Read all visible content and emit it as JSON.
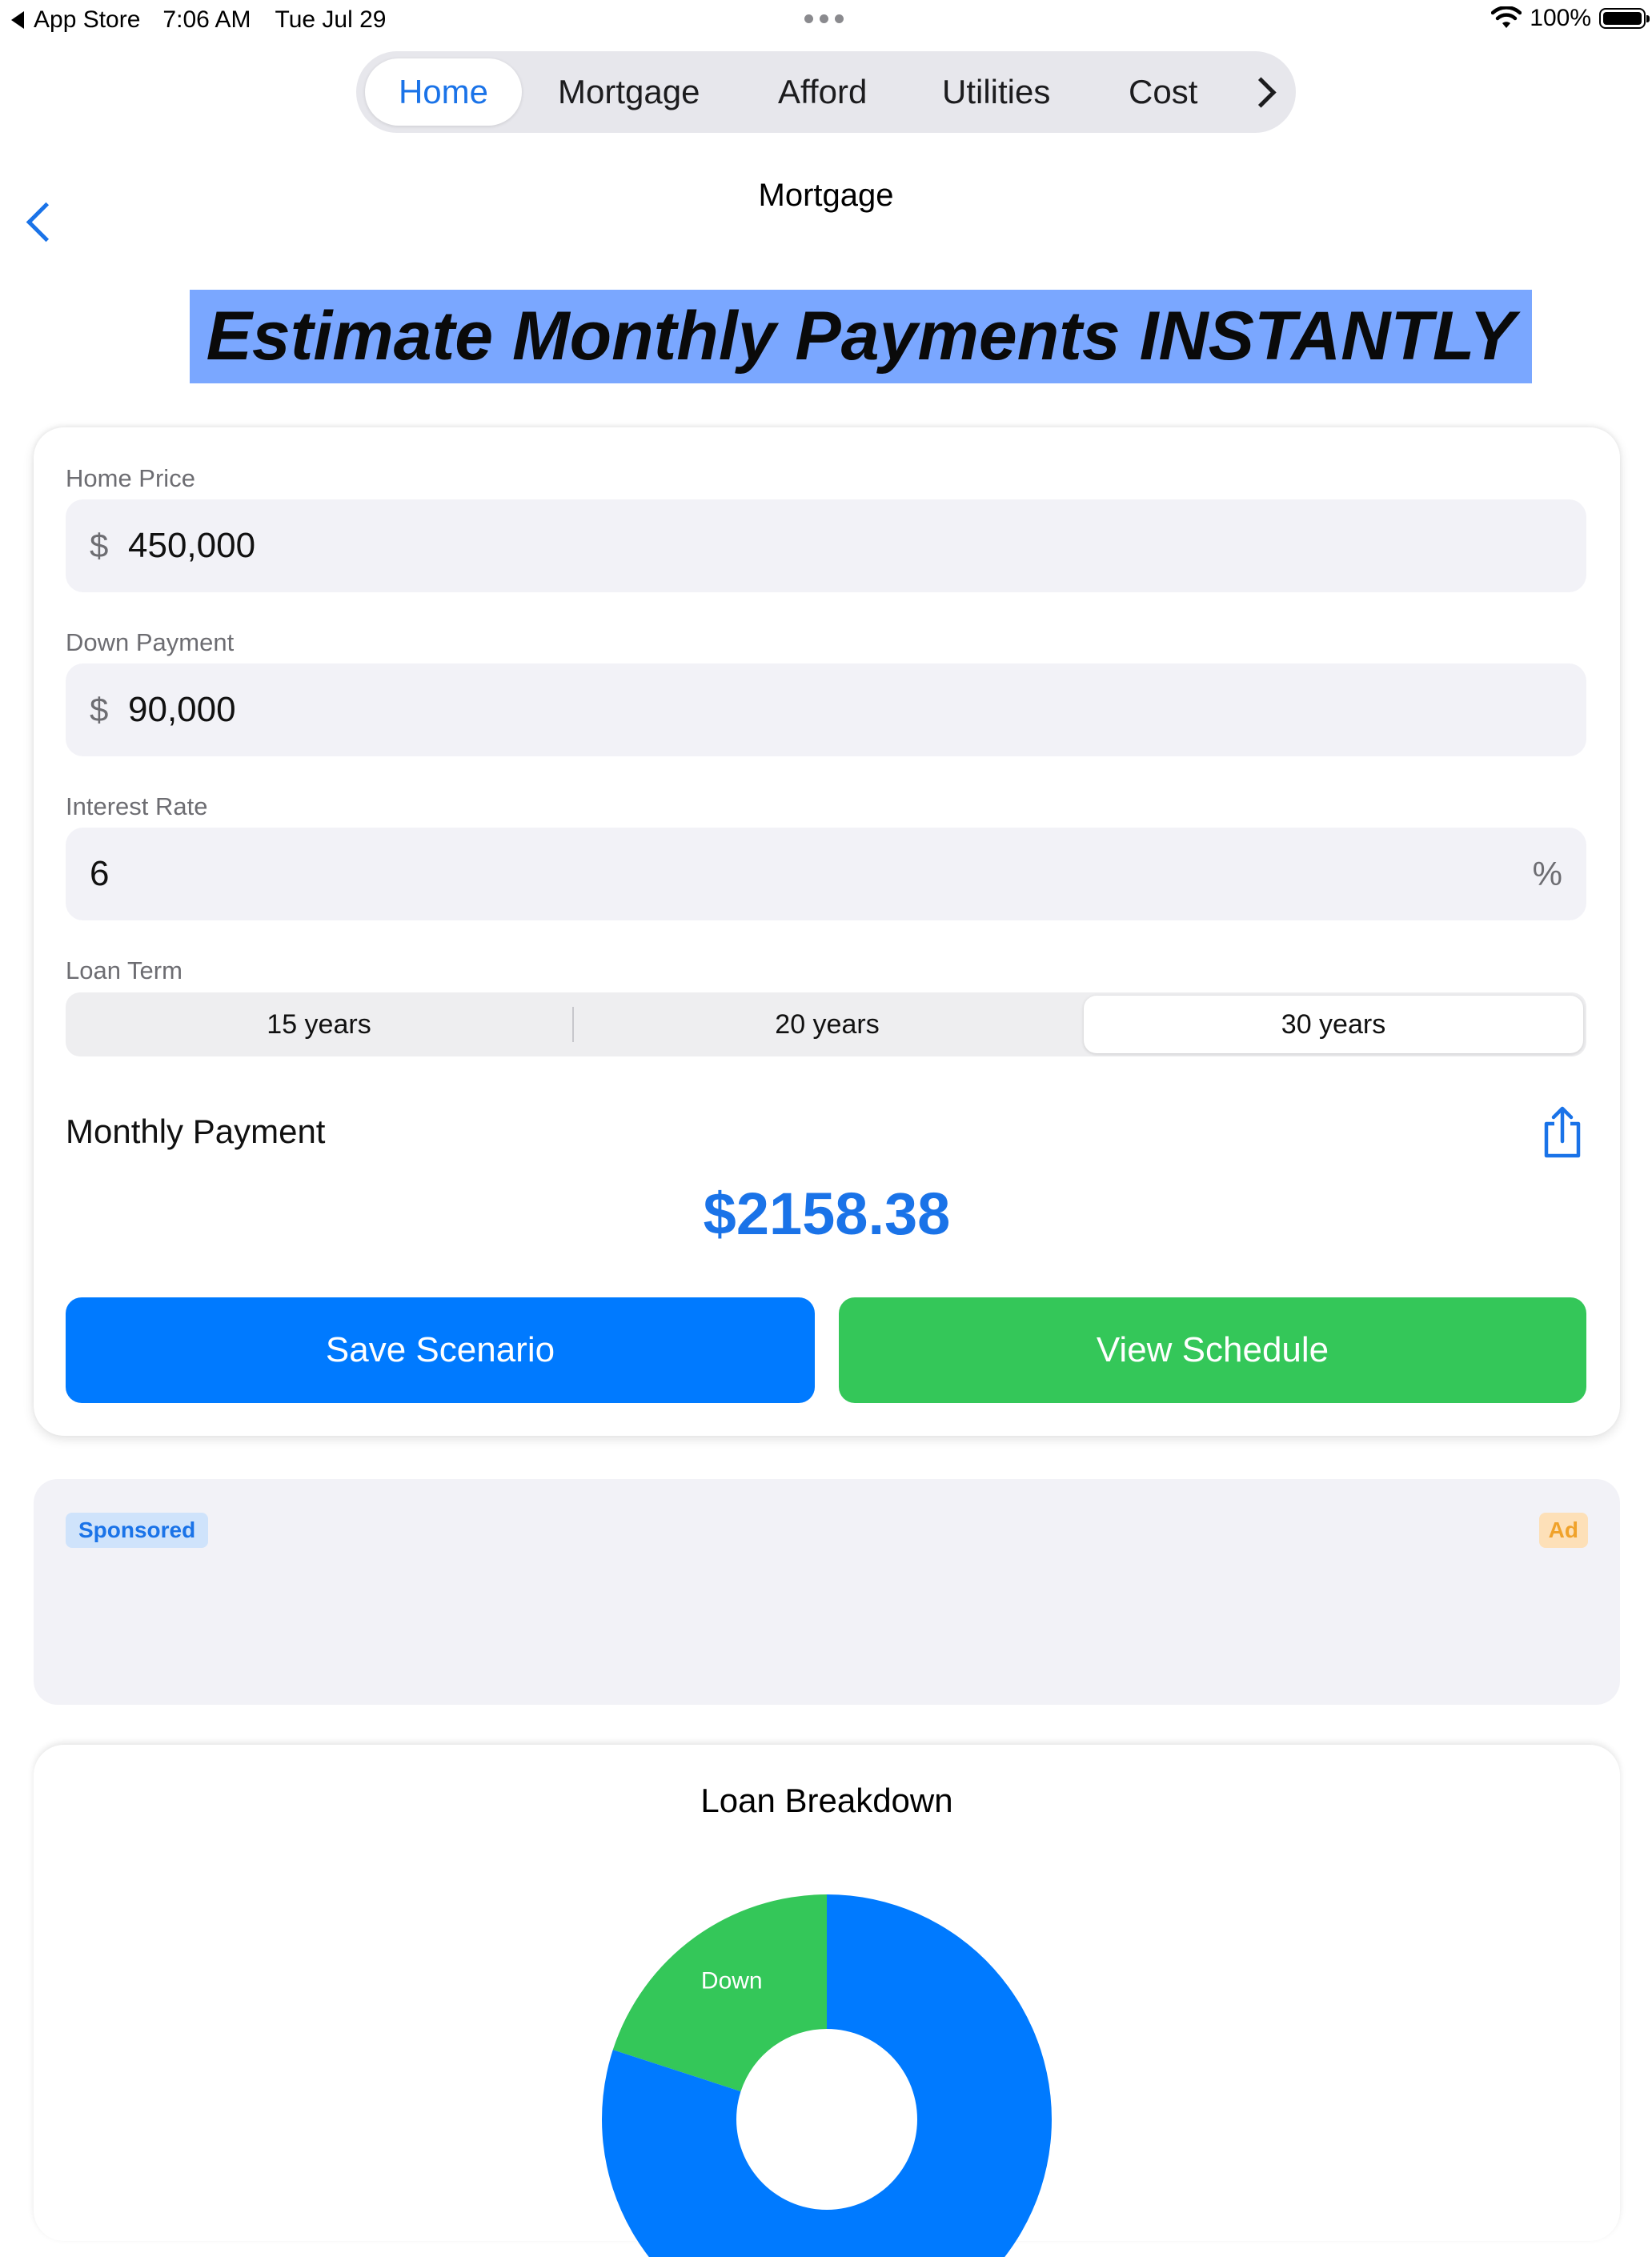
{
  "status_bar": {
    "back_app": "App Store",
    "time": "7:06 AM",
    "date": "Tue Jul 29",
    "battery": "100%"
  },
  "tabs": [
    {
      "label": "Home",
      "active": true
    },
    {
      "label": "Mortgage",
      "active": false
    },
    {
      "label": "Afford",
      "active": false
    },
    {
      "label": "Utilities",
      "active": false
    },
    {
      "label": "Cost",
      "active": false
    }
  ],
  "nav": {
    "title": "Mortgage"
  },
  "headline": "Estimate Monthly Payments INSTANTLY",
  "form": {
    "home_price": {
      "label": "Home Price",
      "prefix": "$",
      "value": "450,000"
    },
    "down_payment": {
      "label": "Down Payment",
      "prefix": "$",
      "value": "90,000"
    },
    "interest_rate": {
      "label": "Interest Rate",
      "value": "6",
      "suffix": "%"
    },
    "loan_term": {
      "label": "Loan Term",
      "options": [
        "15 years",
        "20 years",
        "30 years"
      ],
      "selected": "30 years"
    }
  },
  "result": {
    "label": "Monthly Payment",
    "value": "$2158.38"
  },
  "buttons": {
    "save": "Save Scenario",
    "schedule": "View Schedule"
  },
  "ad": {
    "sponsored": "Sponsored",
    "ad_badge": "Ad"
  },
  "breakdown": {
    "title": "Loan Breakdown",
    "slices": [
      {
        "label": "Down",
        "value": 90000,
        "color": "#34c759"
      },
      {
        "label": "",
        "value": 360000,
        "color": "#007aff"
      }
    ]
  },
  "colors": {
    "accent": "#1a73e8",
    "primary_button": "#007aff",
    "secondary_button": "#34c759",
    "headline_highlight": "#7aa7ff"
  }
}
